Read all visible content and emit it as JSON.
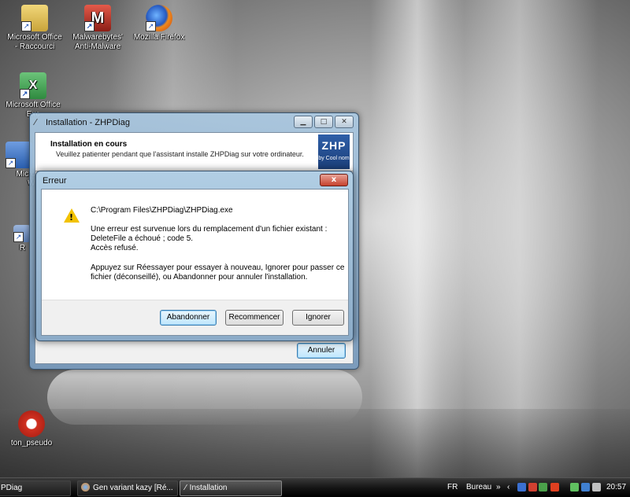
{
  "desktop": {
    "icons": [
      {
        "label": "Microsoft Office\n- Raccourci",
        "icon": "office-folder-icon",
        "color": "#c9a43a"
      },
      {
        "label": "Malwarebytes'\nAnti-Malware",
        "icon": "malwarebytes-icon",
        "color": "#b23a2f"
      },
      {
        "label": "Mozilla Firefox",
        "icon": "firefox-icon",
        "color": "#e66b1f"
      },
      {
        "label": "Microsoft Office\nExc",
        "icon": "excel-icon",
        "color": "#2f8a3f"
      },
      {
        "label": "Micros\nWo",
        "icon": "word-icon",
        "color": "#2a5fb0"
      },
      {
        "label": "R",
        "icon": "shortcut-icon",
        "color": "#5a7bb0"
      },
      {
        "label": "ton_pseudo",
        "icon": "combofix-icon",
        "color": "#d03020"
      }
    ]
  },
  "installer": {
    "title": "Installation - ZHPDiag",
    "header_title": "Installation en cours",
    "header_subtitle": "Veuillez patienter pendant que l'assistant installe ZHPDiag sur votre ordinateur.",
    "logo_big": "ZHP",
    "logo_small": "by Cool nom",
    "cancel_label": "Annuler"
  },
  "error_dialog": {
    "title": "Erreur",
    "path": "C:\\Program Files\\ZHPDiag\\ZHPDiag.exe",
    "line1": "Une erreur est survenue lors du remplacement d'un fichier existant :",
    "line2": "DeleteFile a échoué ; code 5.",
    "line3": "Accès refusé.",
    "line4": "Appuyez sur Réessayer pour essayer à nouveau, Ignorer pour passer ce",
    "line5": "fichier (déconseillé), ou Abandonner pour annuler l'installation.",
    "buttons": {
      "abort": "Abandonner",
      "retry": "Recommencer",
      "ignore": "Ignorer"
    },
    "close_label": "x"
  },
  "taskbar": {
    "items": [
      {
        "label": "PDiag"
      },
      {
        "label": "Gen variant kazy [Ré..."
      },
      {
        "label": "Installation"
      }
    ],
    "lang": "FR",
    "bureau": "Bureau",
    "chevron": "»",
    "time": "20:57"
  }
}
